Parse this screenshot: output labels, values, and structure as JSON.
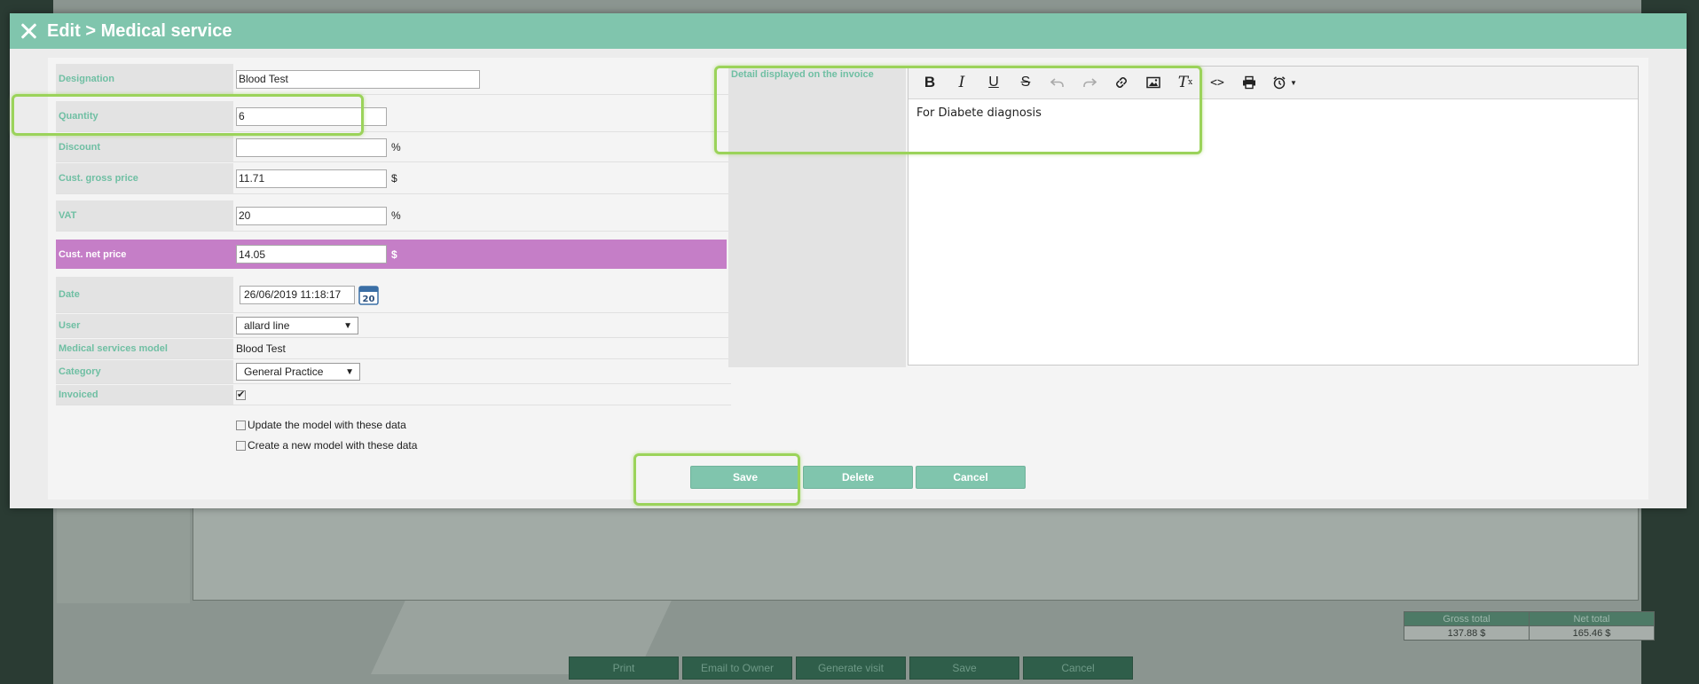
{
  "modal": {
    "title": "Edit > Medical service"
  },
  "form": {
    "designation": {
      "label": "Designation",
      "value": "Blood Test"
    },
    "quantity": {
      "label": "Quantity",
      "value": "6"
    },
    "discount": {
      "label": "Discount",
      "value": "",
      "unit": "%"
    },
    "gross_price": {
      "label": "Cust. gross price",
      "value": "11.71",
      "unit": "$"
    },
    "vat": {
      "label": "VAT",
      "value": "20",
      "unit": "%"
    },
    "net_price": {
      "label": "Cust. net price",
      "value": "14.05",
      "unit": "$"
    },
    "date": {
      "label": "Date",
      "value": "26/06/2019 11:18:17",
      "calendar_day": "20"
    },
    "user": {
      "label": "User",
      "value": "allard line"
    },
    "model": {
      "label": "Medical services model",
      "value": "Blood Test"
    },
    "category": {
      "label": "Category",
      "value": "General Practice"
    },
    "invoiced": {
      "label": "Invoiced",
      "checked": true
    },
    "update_model": {
      "label": "Update the model with these data",
      "checked": false
    },
    "create_model": {
      "label": "Create a new model with these data",
      "checked": false
    }
  },
  "editor": {
    "label": "Detail displayed on the invoice",
    "content": "For Diabete diagnosis"
  },
  "buttons": {
    "save": "Save",
    "delete": "Delete",
    "cancel": "Cancel"
  },
  "background": {
    "totals": {
      "headers": [
        "Gross total",
        "Net total"
      ],
      "values": [
        "137.88 $",
        "165.46 $"
      ]
    },
    "buttons": [
      "Print",
      "Email to Owner",
      "Generate visit",
      "Save",
      "Cancel"
    ]
  },
  "colors": {
    "accent": "#80c5ad",
    "highlight_row": "#c57ec7",
    "annotation": "#9bd35a"
  }
}
